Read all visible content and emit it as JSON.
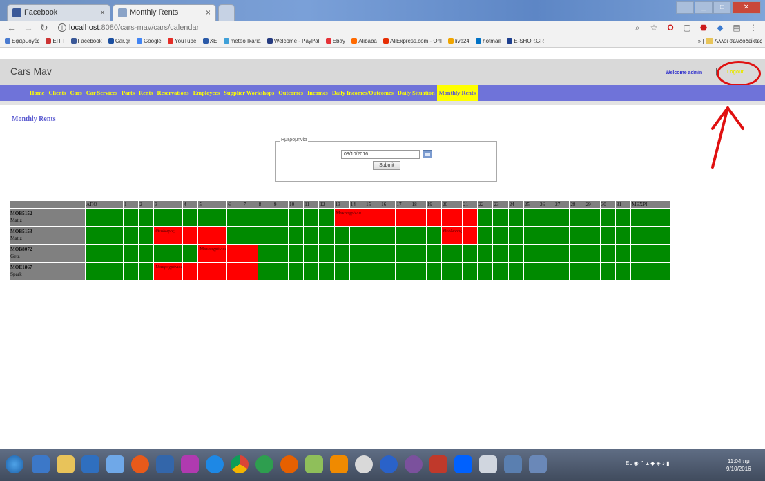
{
  "browser": {
    "tabs": [
      {
        "title": "Facebook",
        "active": false
      },
      {
        "title": "Monthly Rents",
        "active": true
      }
    ],
    "url_host": "localhost",
    "url_port": ":8080",
    "url_path": "/cars-mav/cars/calendar",
    "bookmarks": [
      "Εφαρμογές",
      "ΕΠΠ",
      "Facebook",
      "Car.gr",
      "Google",
      "YouTube",
      "XE",
      "meteo Ikaria",
      "Welcome - PayPal",
      "Ebay",
      "Alibaba",
      "AliExpress.com - Onl",
      "live24",
      "hotmail",
      "E-SHOP.GR"
    ],
    "bookmarks_overflow": "»",
    "other_bookmarks": "Άλλοι σελιδοδείκτες"
  },
  "app": {
    "title": "Cars Mav",
    "welcome": "Welcome admin",
    "separator": "|",
    "logout": "Logout"
  },
  "menu": [
    {
      "label": "Home",
      "active": false
    },
    {
      "label": "Clients",
      "active": false
    },
    {
      "label": "Cars",
      "active": false
    },
    {
      "label": "Car Services",
      "active": false
    },
    {
      "label": "Parts",
      "active": false
    },
    {
      "label": "Rents",
      "active": false
    },
    {
      "label": "Reservations",
      "active": false
    },
    {
      "label": "Employees",
      "active": false
    },
    {
      "label": "Supplier Workshops",
      "active": false
    },
    {
      "label": "Outcomes",
      "active": false
    },
    {
      "label": "Incomes",
      "active": false
    },
    {
      "label": "Daily Incomes/Outcomes",
      "active": false
    },
    {
      "label": "Daily Situation",
      "active": false
    },
    {
      "label": "Monthly Rents",
      "active": true
    }
  ],
  "page": {
    "heading": "Monthly Rents",
    "form": {
      "legend": "Ημερομηνία",
      "date_value": "09/10/2016",
      "submit_label": "Submit"
    }
  },
  "calendar": {
    "header": [
      "",
      "ΑΠΟ",
      "1",
      "2",
      "3",
      "4",
      "5",
      "6",
      "7",
      "8",
      "9",
      "10",
      "11",
      "12",
      "13",
      "14",
      "15",
      "16",
      "17",
      "18",
      "19",
      "20",
      "21",
      "22",
      "23",
      "24",
      "25",
      "26",
      "27",
      "28",
      "29",
      "30",
      "31",
      "ΜΕΧΡΙ"
    ],
    "rows": [
      {
        "plate": "MOB5152",
        "model": "Matiz",
        "cells": [
          {
            "span": 1,
            "busy": false
          },
          {
            "span": 1,
            "busy": false
          },
          {
            "span": 1,
            "busy": false
          },
          {
            "span": 1,
            "busy": false
          },
          {
            "span": 1,
            "busy": false
          },
          {
            "span": 1,
            "busy": false
          },
          {
            "span": 1,
            "busy": false
          },
          {
            "span": 1,
            "busy": false
          },
          {
            "span": 1,
            "busy": false
          },
          {
            "span": 1,
            "busy": false
          },
          {
            "span": 1,
            "busy": false
          },
          {
            "span": 1,
            "busy": false
          },
          {
            "span": 1,
            "busy": false
          },
          {
            "span": 3,
            "busy": true,
            "label": "Μακροχρόνια"
          },
          {
            "span": 1,
            "busy": true
          },
          {
            "span": 1,
            "busy": true
          },
          {
            "span": 1,
            "busy": true
          },
          {
            "span": 1,
            "busy": true
          },
          {
            "span": 1,
            "busy": true
          },
          {
            "span": 1,
            "busy": true
          },
          {
            "span": 1,
            "busy": false
          },
          {
            "span": 1,
            "busy": false
          },
          {
            "span": 1,
            "busy": false
          },
          {
            "span": 1,
            "busy": false
          },
          {
            "span": 1,
            "busy": false
          },
          {
            "span": 1,
            "busy": false
          },
          {
            "span": 1,
            "busy": false
          },
          {
            "span": 1,
            "busy": false
          },
          {
            "span": 1,
            "busy": false
          },
          {
            "span": 1,
            "busy": false
          },
          {
            "span": 1,
            "busy": false
          }
        ]
      },
      {
        "plate": "MOB5153",
        "model": "Matiz",
        "cells": [
          {
            "span": 1,
            "busy": false
          },
          {
            "span": 1,
            "busy": false
          },
          {
            "span": 1,
            "busy": false
          },
          {
            "span": 1,
            "busy": true,
            "label": "Θεόδωρος"
          },
          {
            "span": 1,
            "busy": true
          },
          {
            "span": 1,
            "busy": true
          },
          {
            "span": 1,
            "busy": false
          },
          {
            "span": 1,
            "busy": false
          },
          {
            "span": 1,
            "busy": false
          },
          {
            "span": 1,
            "busy": false
          },
          {
            "span": 1,
            "busy": false
          },
          {
            "span": 1,
            "busy": false
          },
          {
            "span": 1,
            "busy": false
          },
          {
            "span": 1,
            "busy": false
          },
          {
            "span": 1,
            "busy": false
          },
          {
            "span": 1,
            "busy": false
          },
          {
            "span": 1,
            "busy": false
          },
          {
            "span": 1,
            "busy": false
          },
          {
            "span": 1,
            "busy": false
          },
          {
            "span": 1,
            "busy": false
          },
          {
            "span": 1,
            "busy": true,
            "label": "Θεόδωρος"
          },
          {
            "span": 1,
            "busy": true
          },
          {
            "span": 1,
            "busy": false
          },
          {
            "span": 1,
            "busy": false
          },
          {
            "span": 1,
            "busy": false
          },
          {
            "span": 1,
            "busy": false
          },
          {
            "span": 1,
            "busy": false
          },
          {
            "span": 1,
            "busy": false
          },
          {
            "span": 1,
            "busy": false
          },
          {
            "span": 1,
            "busy": false
          },
          {
            "span": 1,
            "busy": false
          },
          {
            "span": 1,
            "busy": false
          },
          {
            "span": 1,
            "busy": false
          }
        ]
      },
      {
        "plate": "MOB8072",
        "model": "Getz",
        "cells": [
          {
            "span": 1,
            "busy": false
          },
          {
            "span": 1,
            "busy": false
          },
          {
            "span": 1,
            "busy": false
          },
          {
            "span": 1,
            "busy": false
          },
          {
            "span": 1,
            "busy": false
          },
          {
            "span": 1,
            "busy": true,
            "label": "Μακροχρόνιος"
          },
          {
            "span": 1,
            "busy": true
          },
          {
            "span": 1,
            "busy": true
          },
          {
            "span": 1,
            "busy": false
          },
          {
            "span": 1,
            "busy": false
          },
          {
            "span": 1,
            "busy": false
          },
          {
            "span": 1,
            "busy": false
          },
          {
            "span": 1,
            "busy": false
          },
          {
            "span": 1,
            "busy": false
          },
          {
            "span": 1,
            "busy": false
          },
          {
            "span": 1,
            "busy": false
          },
          {
            "span": 1,
            "busy": false
          },
          {
            "span": 1,
            "busy": false
          },
          {
            "span": 1,
            "busy": false
          },
          {
            "span": 1,
            "busy": false
          },
          {
            "span": 1,
            "busy": false
          },
          {
            "span": 1,
            "busy": false
          },
          {
            "span": 1,
            "busy": false
          },
          {
            "span": 1,
            "busy": false
          },
          {
            "span": 1,
            "busy": false
          },
          {
            "span": 1,
            "busy": false
          },
          {
            "span": 1,
            "busy": false
          },
          {
            "span": 1,
            "busy": false
          },
          {
            "span": 1,
            "busy": false
          },
          {
            "span": 1,
            "busy": false
          },
          {
            "span": 1,
            "busy": false
          },
          {
            "span": 1,
            "busy": false
          },
          {
            "span": 1,
            "busy": false
          }
        ]
      },
      {
        "plate": "MOE1867",
        "model": "Spark",
        "cells": [
          {
            "span": 1,
            "busy": false
          },
          {
            "span": 1,
            "busy": false
          },
          {
            "span": 1,
            "busy": false
          },
          {
            "span": 1,
            "busy": true,
            "label": "Μακροχρόνιος"
          },
          {
            "span": 1,
            "busy": true
          },
          {
            "span": 1,
            "busy": true
          },
          {
            "span": 1,
            "busy": true
          },
          {
            "span": 1,
            "busy": true
          },
          {
            "span": 1,
            "busy": false
          },
          {
            "span": 1,
            "busy": false
          },
          {
            "span": 1,
            "busy": false
          },
          {
            "span": 1,
            "busy": false
          },
          {
            "span": 1,
            "busy": false
          },
          {
            "span": 1,
            "busy": false
          },
          {
            "span": 1,
            "busy": false
          },
          {
            "span": 1,
            "busy": false
          },
          {
            "span": 1,
            "busy": false
          },
          {
            "span": 1,
            "busy": false
          },
          {
            "span": 1,
            "busy": false
          },
          {
            "span": 1,
            "busy": false
          },
          {
            "span": 1,
            "busy": false
          },
          {
            "span": 1,
            "busy": false
          },
          {
            "span": 1,
            "busy": false
          },
          {
            "span": 1,
            "busy": false
          },
          {
            "span": 1,
            "busy": false
          },
          {
            "span": 1,
            "busy": false
          },
          {
            "span": 1,
            "busy": false
          },
          {
            "span": 1,
            "busy": false
          },
          {
            "span": 1,
            "busy": false
          },
          {
            "span": 1,
            "busy": false
          },
          {
            "span": 1,
            "busy": false
          },
          {
            "span": 1,
            "busy": false
          },
          {
            "span": 1,
            "busy": false
          }
        ]
      }
    ]
  },
  "taskbar": {
    "language": "EL",
    "time": "11:04 πμ",
    "date": "9/10/2016"
  },
  "colors": {
    "menu_bg": "#6f73d9",
    "menu_text": "#ffff00",
    "free": "#008a00",
    "busy": "#ff0000",
    "annotation": "#e01010"
  }
}
